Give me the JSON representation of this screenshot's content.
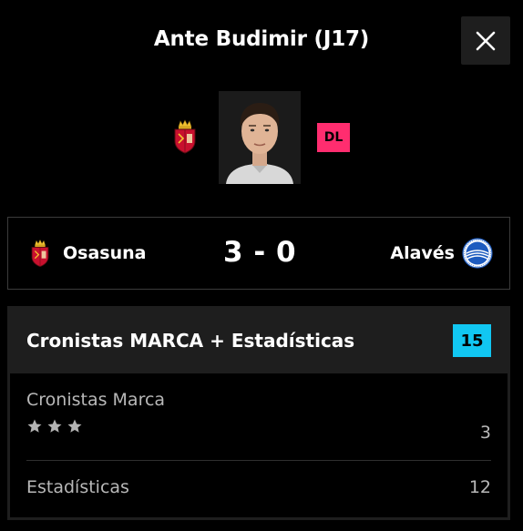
{
  "header": {
    "title": "Ante Budimir (J17)",
    "close_icon": "close-icon"
  },
  "player": {
    "team_crest_icon": "osasuna-crest-icon",
    "photo": "player-photo",
    "position": "DL",
    "position_color": "#ff2d6f"
  },
  "match": {
    "home_team": "Osasuna",
    "home_crest_icon": "osasuna-crest-icon",
    "score": "3 - 0",
    "away_team": "Alavés",
    "away_crest_icon": "alaves-crest-icon"
  },
  "stats": {
    "title": "Cronistas MARCA + Estadísticas",
    "total": "15",
    "total_color": "#11c7f2",
    "rows": [
      {
        "label": "Cronistas Marca",
        "value": "3",
        "stars": 3
      },
      {
        "label": "Estadísticas",
        "value": "12"
      }
    ]
  }
}
